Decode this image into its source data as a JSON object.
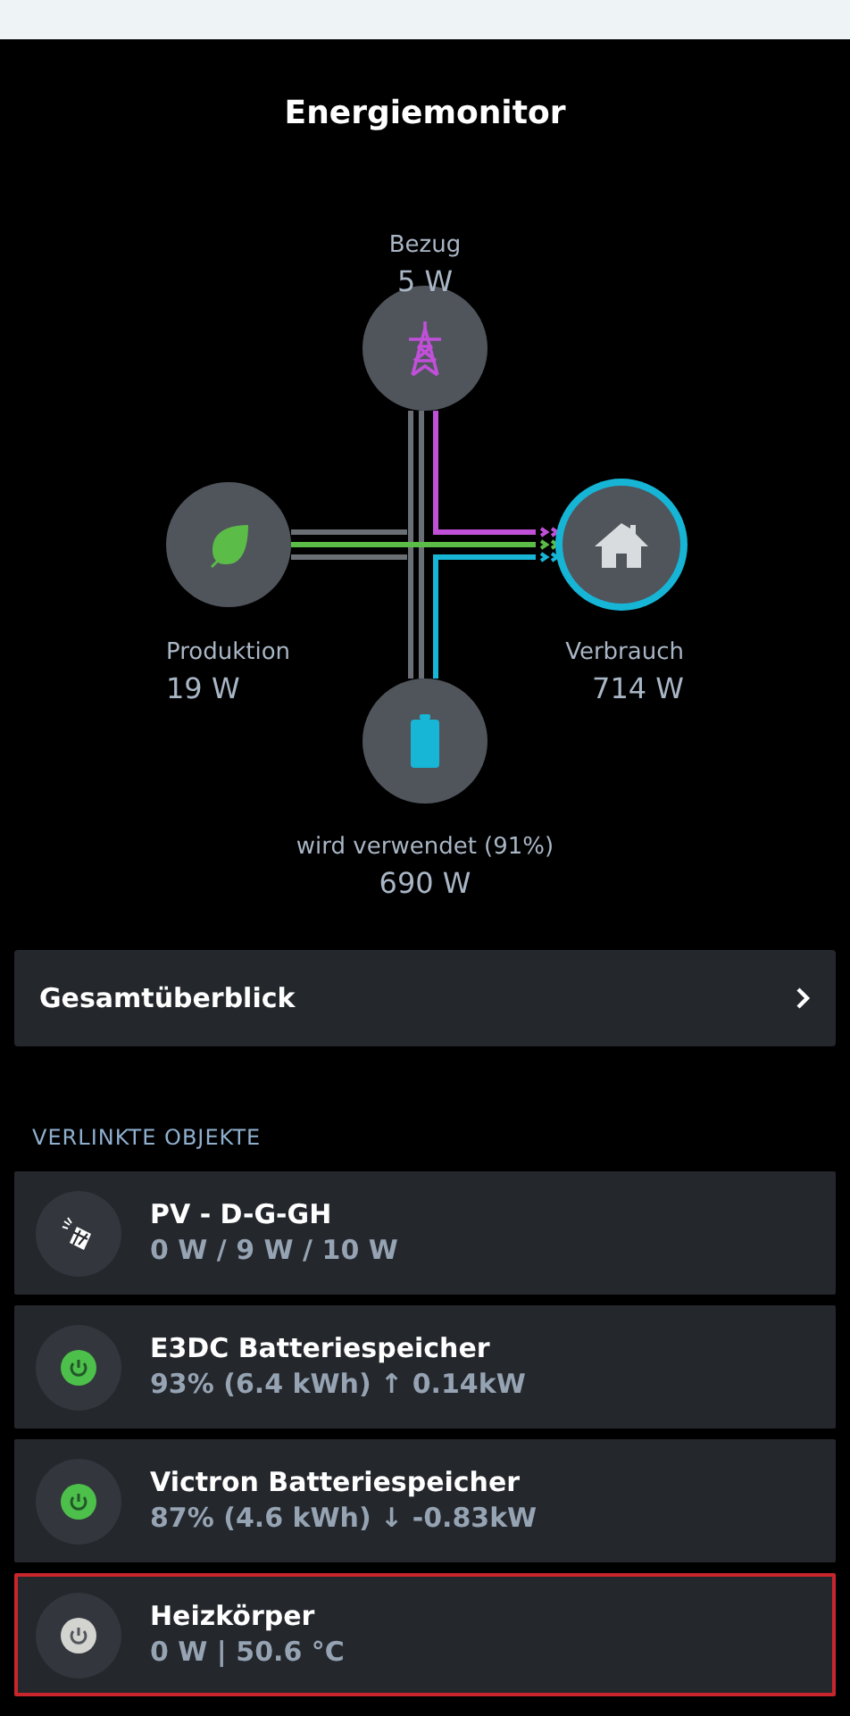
{
  "title": "Energiemonitor",
  "flow_nodes": [
    {
      "kind": "grid",
      "label": "Bezug",
      "value": "5 W"
    },
    {
      "kind": "production",
      "label": "Produktion",
      "value": "19 W"
    },
    {
      "kind": "consumption",
      "label": "Verbrauch",
      "value": "714 W"
    },
    {
      "kind": "battery",
      "label": "wird verwendet (91%)",
      "value": "690 W"
    }
  ],
  "overview": {
    "label": "Gesamtüberblick"
  },
  "section_header": "VERLINKTE OBJEKTE",
  "linked_objects": [
    {
      "kind": "solar",
      "name": "PV - D-G-GH",
      "detail": "0 W / 9 W / 10 W",
      "selected": false
    },
    {
      "kind": "power",
      "on": true,
      "name": "E3DC Batteriespeicher",
      "detail": "93% (6.4 kWh) ↑ 0.14kW",
      "selected": false
    },
    {
      "kind": "power",
      "on": true,
      "name": "Victron Batteriespeicher",
      "detail": "87% (4.6 kWh) ↓ -0.83kW",
      "selected": false
    },
    {
      "kind": "power",
      "on": false,
      "name": "Heizkörper",
      "detail": "0 W | 50.6 °C",
      "selected": true
    }
  ]
}
